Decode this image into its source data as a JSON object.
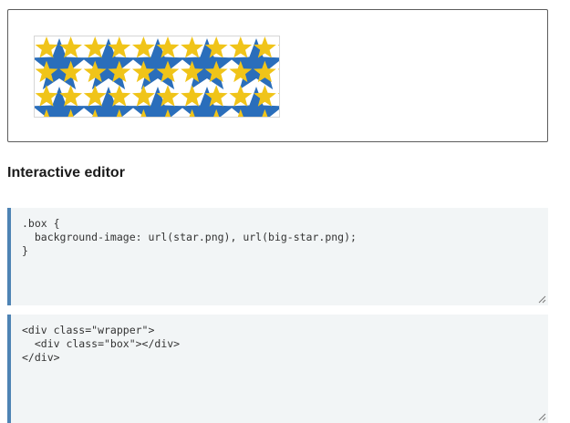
{
  "heading": "Interactive editor",
  "colors": {
    "small_star": "#f0c419",
    "big_star": "#2a6ebb",
    "editor_bg": "#f2f5f6",
    "editor_accent": "#4e83b4"
  },
  "css_editor": {
    "line1": ".box {",
    "line2": "  background-image: url(star.png), url(big-star.png);",
    "line3": "}"
  },
  "html_editor": {
    "line1": "<div class=\"wrapper\">",
    "line2": "  <div class=\"box\"></div>",
    "line3": "</div>"
  },
  "icons": {
    "resize": "resize-grip-icon"
  }
}
